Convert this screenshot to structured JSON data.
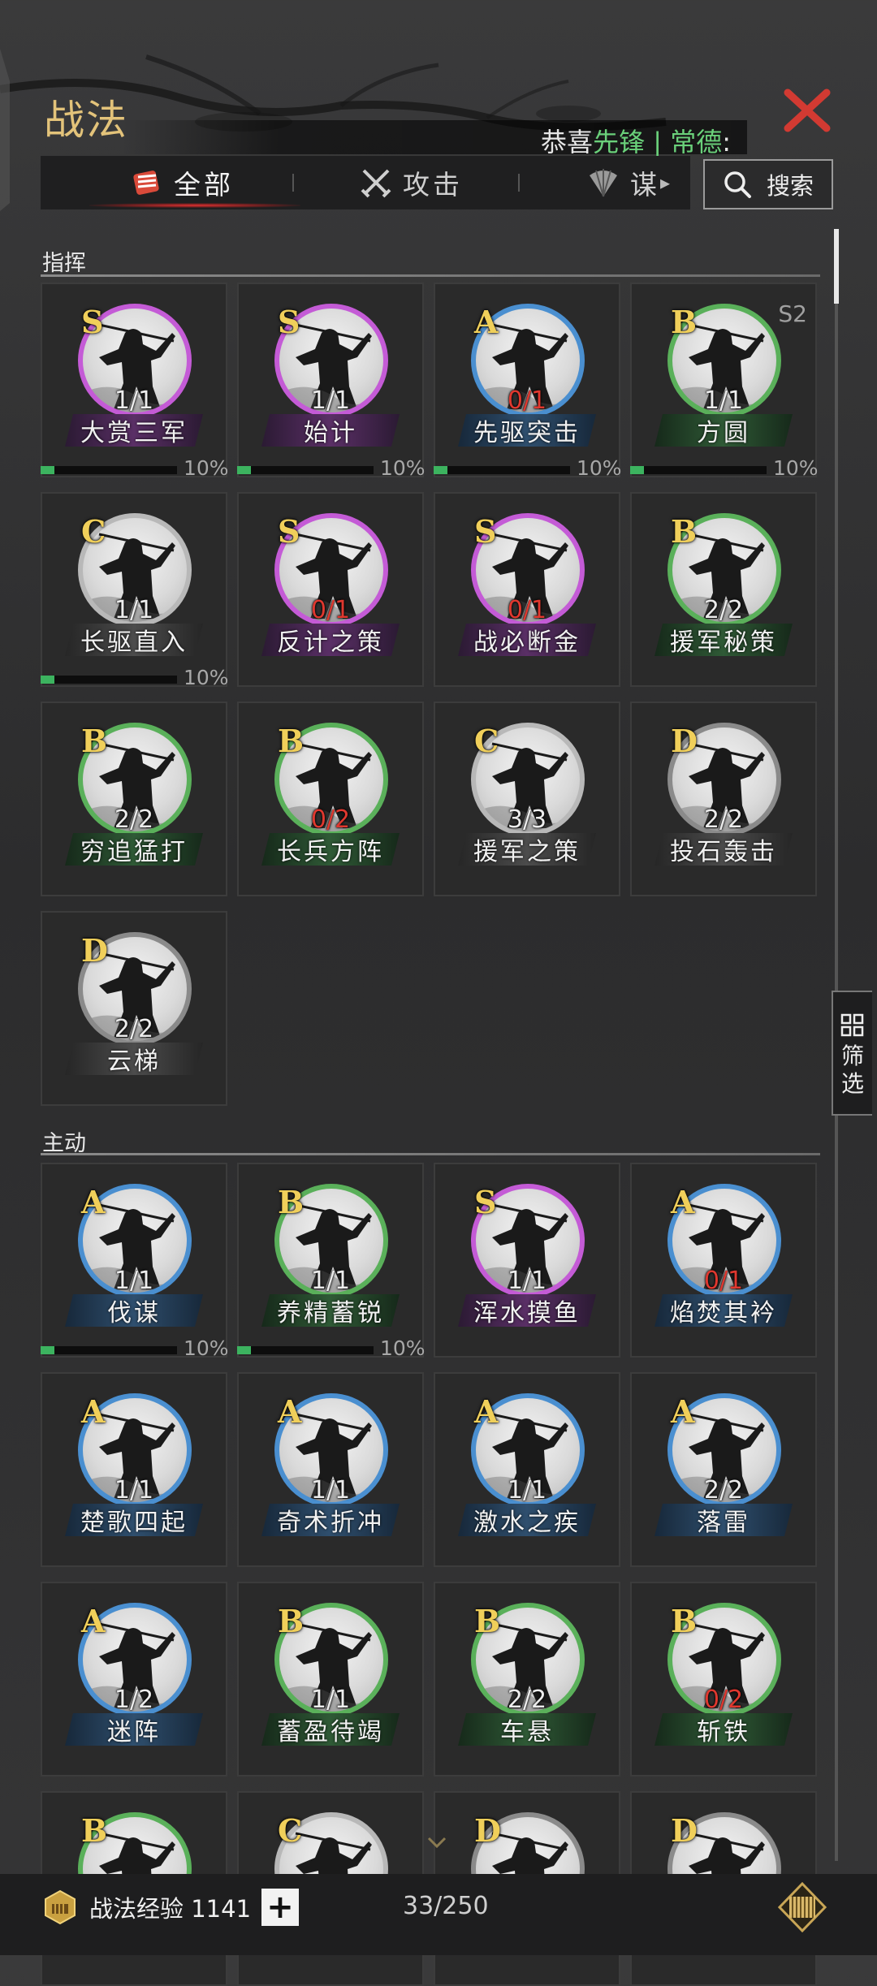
{
  "header": {
    "title": "战法",
    "ticker_prefix": "恭喜",
    "ticker_name": "先锋",
    "ticker_sep": " | ",
    "ticker_person": "常德",
    "ticker_suffix": ":"
  },
  "tabs": [
    {
      "label": "全部"
    },
    {
      "label": "攻击"
    },
    {
      "label": "谋"
    }
  ],
  "search": {
    "label": "搜索"
  },
  "filter": {
    "line1": "筛",
    "line2": "选"
  },
  "sections": [
    {
      "label": "指挥"
    },
    {
      "label": "主动"
    }
  ],
  "accent_colors": {
    "grade": "#f0cf5a",
    "count_red": "#e0382f",
    "progress": "#3cb35f",
    "close": "#d23a32",
    "ticker_green": "#6ad07a"
  },
  "cards": [
    {
      "grade": "S",
      "count": "1/1",
      "name": "大赏三军",
      "ring": "#c45bd6",
      "bar": "purple",
      "progress": "10%",
      "progress_value": 0.1
    },
    {
      "grade": "S",
      "count": "1/1",
      "name": "始计",
      "ring": "#c45bd6",
      "bar": "purple",
      "progress": "10%",
      "progress_value": 0.1
    },
    {
      "grade": "A",
      "count": "0/1",
      "count_red": true,
      "name": "先驱突击",
      "ring": "#4a8fd0",
      "bar": "blue",
      "progress": "10%",
      "progress_value": 0.1
    },
    {
      "grade": "B",
      "count": "1/1",
      "name": "方圆",
      "ring": "#5ab05a",
      "bar": "green",
      "progress": "10%",
      "progress_value": 0.1,
      "season": "S2"
    },
    {
      "grade": "C",
      "count": "1/1",
      "name": "长驱直入",
      "ring": "#b8b8b8",
      "bar": "gray",
      "progress": "10%",
      "progress_value": 0.1
    },
    {
      "grade": "S",
      "count": "0/1",
      "count_red": true,
      "name": "反计之策",
      "ring": "#c45bd6",
      "bar": "purple"
    },
    {
      "grade": "S",
      "count": "0/1",
      "count_red": true,
      "name": "战必断金",
      "ring": "#c45bd6",
      "bar": "purple"
    },
    {
      "grade": "B",
      "count": "2/2",
      "name": "援军秘策",
      "ring": "#5ab05a",
      "bar": "green"
    },
    {
      "grade": "B",
      "count": "2/2",
      "name": "穷追猛打",
      "ring": "#5ab05a",
      "bar": "green"
    },
    {
      "grade": "B",
      "count": "0/2",
      "count_red": true,
      "name": "长兵方阵",
      "ring": "#5ab05a",
      "bar": "green"
    },
    {
      "grade": "C",
      "count": "3/3",
      "name": "援军之策",
      "ring": "#b8b8b8",
      "bar": "gray"
    },
    {
      "grade": "D",
      "count": "2/2",
      "name": "投石轰击",
      "ring": "#8a8a8a",
      "bar": "gray"
    },
    {
      "grade": "D",
      "count": "2/2",
      "name": "云梯",
      "ring": "#8a8a8a",
      "bar": "gray"
    },
    {
      "grade": "A",
      "count": "1/1",
      "name": "伐谋",
      "ring": "#4a8fd0",
      "bar": "blue",
      "progress": "10%",
      "progress_value": 0.1
    },
    {
      "grade": "B",
      "count": "1/1",
      "name": "养精蓄锐",
      "ring": "#5ab05a",
      "bar": "green",
      "progress": "10%",
      "progress_value": 0.1
    },
    {
      "grade": "S",
      "count": "1/1",
      "name": "浑水摸鱼",
      "ring": "#c45bd6",
      "bar": "purple"
    },
    {
      "grade": "A",
      "count": "0/1",
      "count_red": true,
      "name": "焰焚其衿",
      "ring": "#4a8fd0",
      "bar": "blue"
    },
    {
      "grade": "A",
      "count": "1/1",
      "name": "楚歌四起",
      "ring": "#4a8fd0",
      "bar": "blue"
    },
    {
      "grade": "A",
      "count": "1/1",
      "name": "奇术折冲",
      "ring": "#4a8fd0",
      "bar": "blue"
    },
    {
      "grade": "A",
      "count": "1/1",
      "name": "激水之疾",
      "ring": "#4a8fd0",
      "bar": "blue"
    },
    {
      "grade": "A",
      "count": "2/2",
      "name": "落雷",
      "ring": "#4a8fd0",
      "bar": "blue"
    },
    {
      "grade": "A",
      "count": "1/2",
      "name": "迷阵",
      "ring": "#4a8fd0",
      "bar": "blue"
    },
    {
      "grade": "B",
      "count": "1/1",
      "name": "蓄盈待竭",
      "ring": "#5ab05a",
      "bar": "green"
    },
    {
      "grade": "B",
      "count": "2/2",
      "name": "车悬",
      "ring": "#5ab05a",
      "bar": "green"
    },
    {
      "grade": "B",
      "count": "0/2",
      "count_red": true,
      "name": "斩铁",
      "ring": "#5ab05a",
      "bar": "green"
    },
    {
      "grade": "B",
      "ring": "#5ab05a",
      "bar": "green"
    },
    {
      "grade": "C",
      "ring": "#b8b8b8",
      "bar": "gray"
    },
    {
      "grade": "D",
      "ring": "#8a8a8a",
      "bar": "gray"
    },
    {
      "grade": "D",
      "ring": "#8a8a8a",
      "bar": "gray"
    }
  ],
  "bottom": {
    "exp_label": "战法经验",
    "exp_value": "1141",
    "plus": "+",
    "page_count": "33/250"
  }
}
